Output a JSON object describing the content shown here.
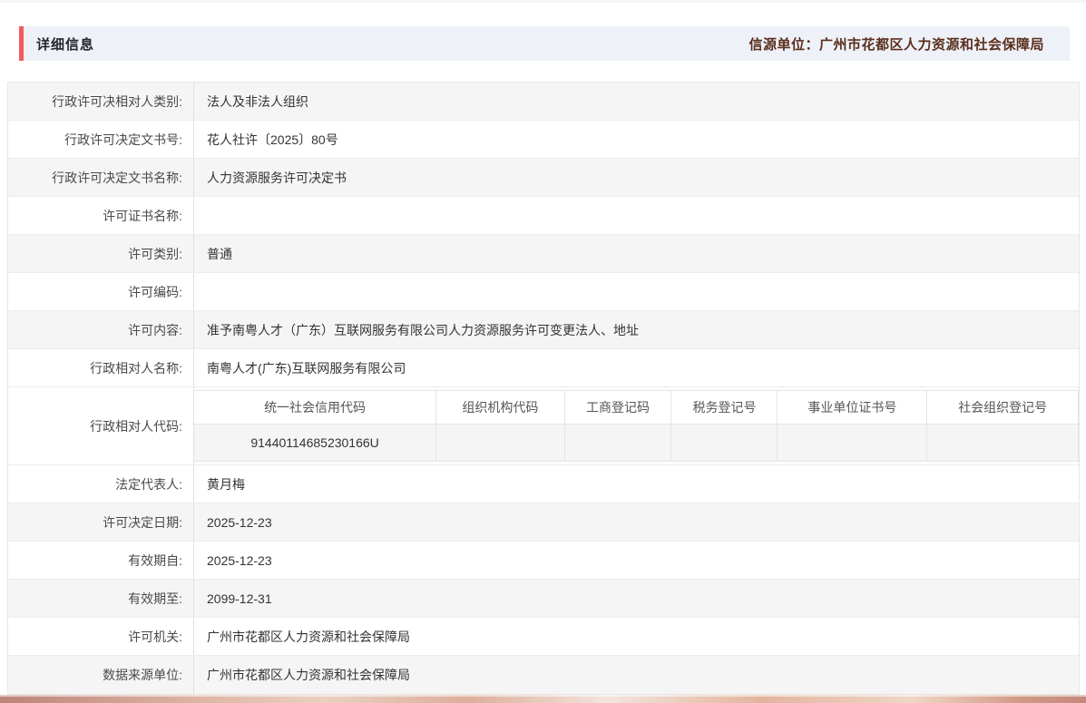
{
  "header": {
    "title": "详细信息",
    "source": "信源单位：广州市花都区人力资源和社会保障局"
  },
  "accent_color": "#f15b5b",
  "table": {
    "rows": [
      {
        "label": "行政许可决相对人类别:",
        "value": "法人及非法人组织"
      },
      {
        "label": "行政许可决定文书号:",
        "value": "花人社许〔2025〕80号"
      },
      {
        "label": "行政许可决定文书名称:",
        "value": "人力资源服务许可决定书"
      },
      {
        "label": "许可证书名称:",
        "value": ""
      },
      {
        "label": "许可类别:",
        "value": "普通"
      },
      {
        "label": "许可编码:",
        "value": ""
      },
      {
        "label": "许可内容:",
        "value": "准予南粤人才（广东）互联网服务有限公司人力资源服务许可变更法人、地址"
      },
      {
        "label": "行政相对人名称:",
        "value": "南粤人才(广东)互联网服务有限公司"
      },
      {
        "label": "法定代表人:",
        "value": "黄月梅"
      },
      {
        "label": "许可决定日期:",
        "value": "2025-12-23"
      },
      {
        "label": "有效期自:",
        "value": "2025-12-23"
      },
      {
        "label": "有效期至:",
        "value": "2099-12-31"
      },
      {
        "label": "许可机关:",
        "value": "广州市花都区人力资源和社会保障局"
      },
      {
        "label": "数据来源单位:",
        "value": "广州市花都区人力资源和社会保障局"
      }
    ],
    "code_row": {
      "label": "行政相对人代码:",
      "columns": [
        "统一社会信用代码",
        "组织机构代码",
        "工商登记码",
        "税务登记号",
        "事业单位证书号",
        "社会组织登记号"
      ],
      "values": [
        "91440114685230166U",
        "",
        "",
        "",
        "",
        ""
      ]
    }
  }
}
